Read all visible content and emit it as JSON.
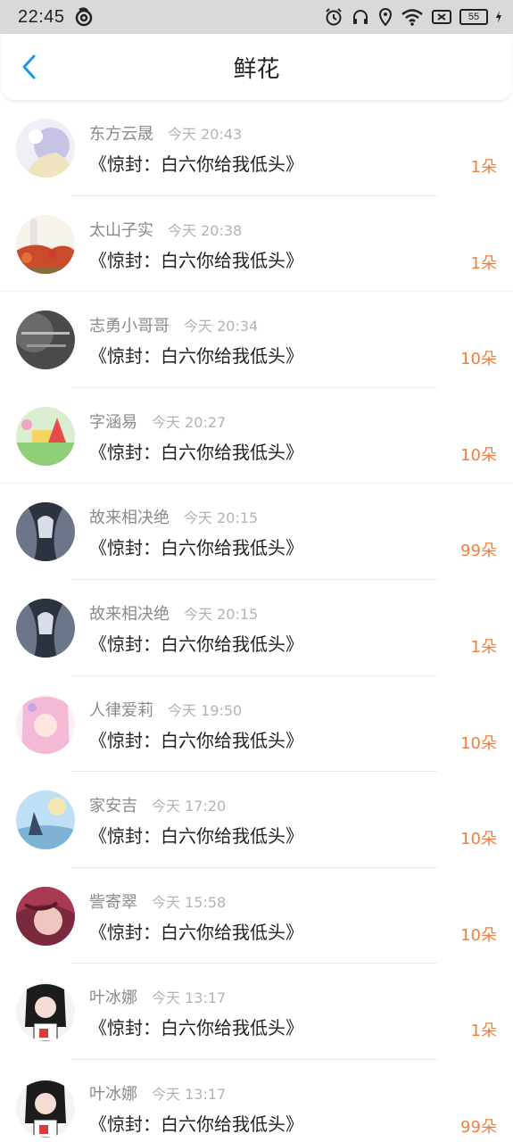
{
  "status_bar": {
    "time": "22:45",
    "battery": "55"
  },
  "header": {
    "title": "鲜花",
    "back_icon": "chevron-left-icon",
    "accent_color": "#1a9bea"
  },
  "colors": {
    "count": "#f07f3c",
    "name": "#8a8a8a",
    "time": "#b3b3b3"
  },
  "items": [
    {
      "name": "东方云晟",
      "time": "今天 20:43",
      "title": "《惊封：白六你给我低头》",
      "count": "1朵"
    },
    {
      "name": "太山子实",
      "time": "今天 20:38",
      "title": "《惊封：白六你给我低头》",
      "count": "1朵"
    },
    {
      "name": "志勇小哥哥",
      "time": "今天 20:34",
      "title": "《惊封：白六你给我低头》",
      "count": "10朵"
    },
    {
      "name": "字涵易",
      "time": "今天 20:27",
      "title": "《惊封：白六你给我低头》",
      "count": "10朵"
    },
    {
      "name": "故来相决绝",
      "time": "今天 20:15",
      "title": "《惊封：白六你给我低头》",
      "count": "99朵"
    },
    {
      "name": "故来相决绝",
      "time": "今天 20:15",
      "title": "《惊封：白六你给我低头》",
      "count": "1朵"
    },
    {
      "name": "人律爱莉",
      "time": "今天 19:50",
      "title": "《惊封：白六你给我低头》",
      "count": "10朵"
    },
    {
      "name": "家安吉",
      "time": "今天 17:20",
      "title": "《惊封：白六你给我低头》",
      "count": "10朵"
    },
    {
      "name": "訾寄翠",
      "time": "今天 15:58",
      "title": "《惊封：白六你给我低头》",
      "count": "10朵"
    },
    {
      "name": "叶冰娜",
      "time": "今天 13:17",
      "title": "《惊封：白六你给我低头》",
      "count": "1朵"
    },
    {
      "name": "叶冰娜",
      "time": "今天 13:17",
      "title": "《惊封：白六你给我低头》",
      "count": "99朵"
    }
  ]
}
